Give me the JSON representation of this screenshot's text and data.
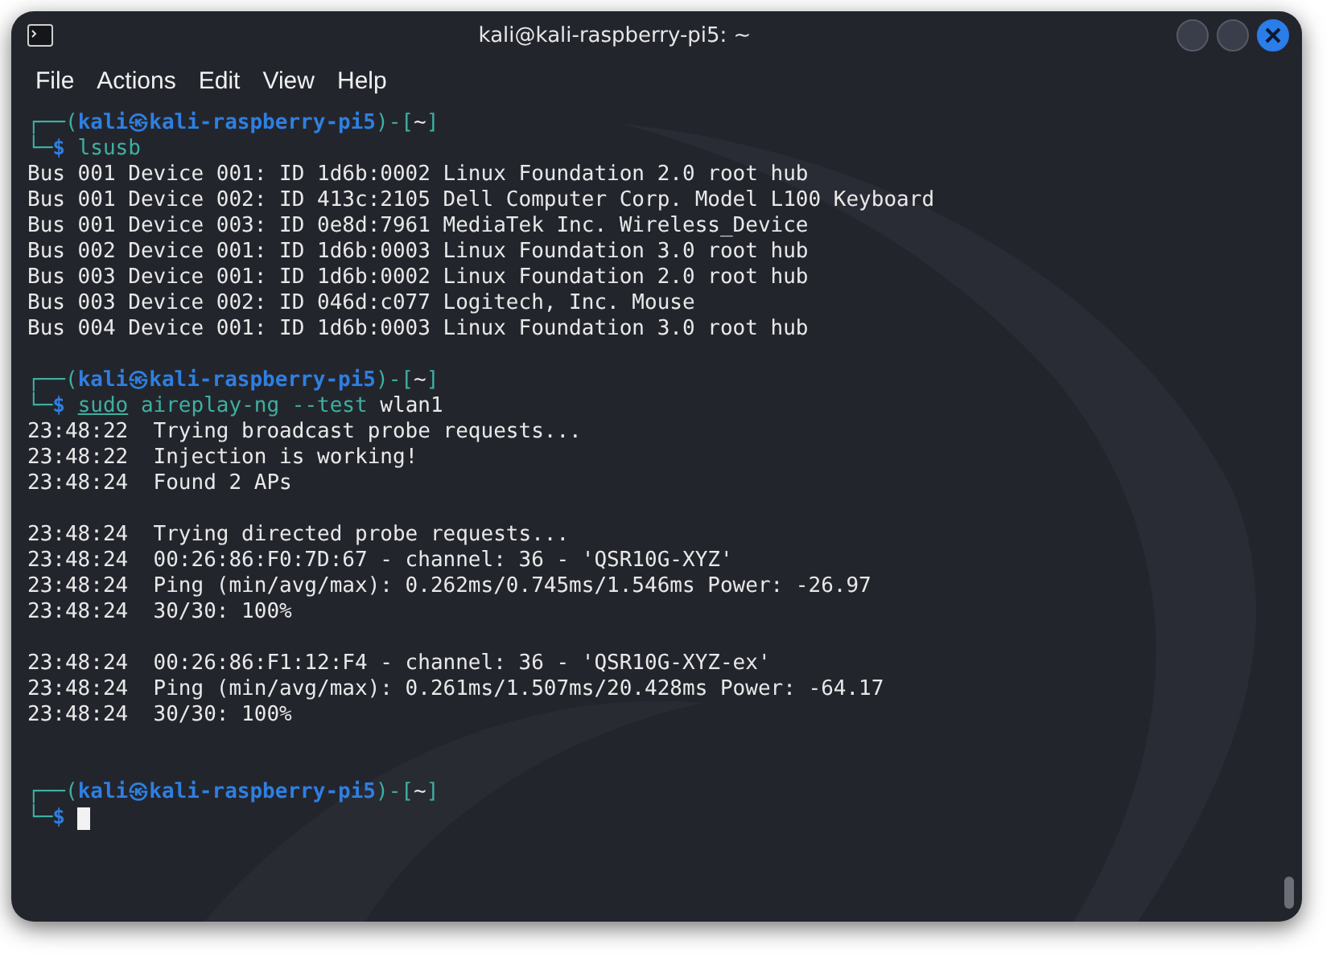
{
  "window": {
    "title": "kali@kali-raspberry-pi5: ~"
  },
  "menu": [
    "File",
    "Actions",
    "Edit",
    "View",
    "Help"
  ],
  "lines": [
    {
      "kind": "text",
      "segments": [
        {
          "text": "┌──(",
          "kind": "frame"
        },
        {
          "text": "kali㉿kali-raspberry-pi5",
          "kind": "host"
        },
        {
          "text": ")-[",
          "kind": "frame"
        },
        {
          "text": "~",
          "kind": "dir"
        },
        {
          "text": "]",
          "kind": "frame"
        }
      ]
    },
    {
      "kind": "text",
      "segments": [
        {
          "text": "└─",
          "kind": "frame"
        },
        {
          "text": "$",
          "kind": "host"
        },
        {
          "text": " lsusb",
          "kind": "command"
        }
      ]
    },
    {
      "kind": "text",
      "segments": [
        {
          "text": "Bus 001 Device 001: ID 1d6b:0002 Linux Foundation 2.0 root hub",
          "kind": "plain"
        }
      ]
    },
    {
      "kind": "text",
      "segments": [
        {
          "text": "Bus 001 Device 002: ID 413c:2105 Dell Computer Corp. Model L100 Keyboard",
          "kind": "plain"
        }
      ]
    },
    {
      "kind": "text",
      "segments": [
        {
          "text": "Bus 001 Device 003: ID 0e8d:7961 MediaTek Inc. Wireless_Device",
          "kind": "plain"
        }
      ]
    },
    {
      "kind": "text",
      "segments": [
        {
          "text": "Bus 002 Device 001: ID 1d6b:0003 Linux Foundation 3.0 root hub",
          "kind": "plain"
        }
      ]
    },
    {
      "kind": "text",
      "segments": [
        {
          "text": "Bus 003 Device 001: ID 1d6b:0002 Linux Foundation 2.0 root hub",
          "kind": "plain"
        }
      ]
    },
    {
      "kind": "text",
      "segments": [
        {
          "text": "Bus 003 Device 002: ID 046d:c077 Logitech, Inc. Mouse",
          "kind": "plain"
        }
      ]
    },
    {
      "kind": "text",
      "segments": [
        {
          "text": "Bus 004 Device 001: ID 1d6b:0003 Linux Foundation 3.0 root hub",
          "kind": "plain"
        }
      ]
    },
    {
      "kind": "blank"
    },
    {
      "kind": "text",
      "segments": [
        {
          "text": "┌──(",
          "kind": "frame"
        },
        {
          "text": "kali㉿kali-raspberry-pi5",
          "kind": "host"
        },
        {
          "text": ")-[",
          "kind": "frame"
        },
        {
          "text": "~",
          "kind": "dir"
        },
        {
          "text": "]",
          "kind": "frame"
        }
      ]
    },
    {
      "kind": "text",
      "segments": [
        {
          "text": "└─",
          "kind": "frame"
        },
        {
          "text": "$ ",
          "kind": "host"
        },
        {
          "text": "sudo",
          "kind": "sudo"
        },
        {
          "text": " aireplay-ng --test",
          "kind": "command"
        },
        {
          "text": " wlan1",
          "kind": "plain"
        }
      ]
    },
    {
      "kind": "text",
      "segments": [
        {
          "text": "23:48:22  Trying broadcast probe requests...",
          "kind": "plain"
        }
      ]
    },
    {
      "kind": "text",
      "segments": [
        {
          "text": "23:48:22  Injection is working!",
          "kind": "plain"
        }
      ]
    },
    {
      "kind": "text",
      "segments": [
        {
          "text": "23:48:24  Found 2 APs",
          "kind": "plain"
        }
      ]
    },
    {
      "kind": "blank"
    },
    {
      "kind": "text",
      "segments": [
        {
          "text": "23:48:24  Trying directed probe requests...",
          "kind": "plain"
        }
      ]
    },
    {
      "kind": "text",
      "segments": [
        {
          "text": "23:48:24  00:26:86:F0:7D:67 - channel: 36 - 'QSR10G-XYZ'",
          "kind": "plain"
        }
      ]
    },
    {
      "kind": "text",
      "segments": [
        {
          "text": "23:48:24  Ping (min/avg/max): 0.262ms/0.745ms/1.546ms Power: -26.97",
          "kind": "plain"
        }
      ]
    },
    {
      "kind": "text",
      "segments": [
        {
          "text": "23:48:24  30/30: 100%",
          "kind": "plain"
        }
      ]
    },
    {
      "kind": "blank"
    },
    {
      "kind": "text",
      "segments": [
        {
          "text": "23:48:24  00:26:86:F1:12:F4 - channel: 36 - 'QSR10G-XYZ-ex'",
          "kind": "plain"
        }
      ]
    },
    {
      "kind": "text",
      "segments": [
        {
          "text": "23:48:24  Ping (min/avg/max): 0.261ms/1.507ms/20.428ms Power: -64.17",
          "kind": "plain"
        }
      ]
    },
    {
      "kind": "text",
      "segments": [
        {
          "text": "23:48:24  30/30: 100%",
          "kind": "plain"
        }
      ]
    },
    {
      "kind": "blank"
    },
    {
      "kind": "blank"
    },
    {
      "kind": "text",
      "segments": [
        {
          "text": "┌──(",
          "kind": "frame"
        },
        {
          "text": "kali㉿kali-raspberry-pi5",
          "kind": "host"
        },
        {
          "text": ")-[",
          "kind": "frame"
        },
        {
          "text": "~",
          "kind": "dir"
        },
        {
          "text": "]",
          "kind": "frame"
        }
      ]
    },
    {
      "kind": "text",
      "cursor": true,
      "segments": [
        {
          "text": "└─",
          "kind": "frame"
        },
        {
          "text": "$",
          "kind": "host"
        }
      ]
    }
  ]
}
